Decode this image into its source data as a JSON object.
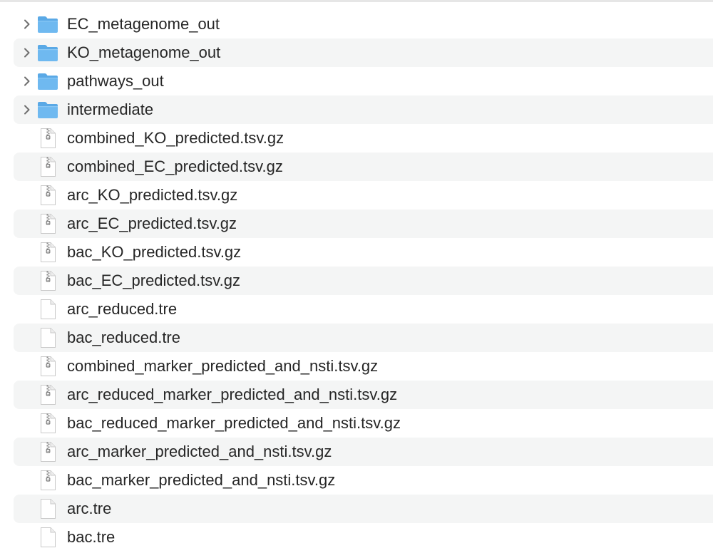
{
  "items": [
    {
      "name": "EC_metagenome_out",
      "kind": "folder"
    },
    {
      "name": "KO_metagenome_out",
      "kind": "folder"
    },
    {
      "name": "pathways_out",
      "kind": "folder"
    },
    {
      "name": "intermediate",
      "kind": "folder"
    },
    {
      "name": "combined_KO_predicted.tsv.gz",
      "kind": "archive"
    },
    {
      "name": "combined_EC_predicted.tsv.gz",
      "kind": "archive"
    },
    {
      "name": "arc_KO_predicted.tsv.gz",
      "kind": "archive"
    },
    {
      "name": "arc_EC_predicted.tsv.gz",
      "kind": "archive"
    },
    {
      "name": "bac_KO_predicted.tsv.gz",
      "kind": "archive"
    },
    {
      "name": "bac_EC_predicted.tsv.gz",
      "kind": "archive"
    },
    {
      "name": "arc_reduced.tre",
      "kind": "document"
    },
    {
      "name": "bac_reduced.tre",
      "kind": "document"
    },
    {
      "name": "combined_marker_predicted_and_nsti.tsv.gz",
      "kind": "archive"
    },
    {
      "name": "arc_reduced_marker_predicted_and_nsti.tsv.gz",
      "kind": "archive"
    },
    {
      "name": "bac_reduced_marker_predicted_and_nsti.tsv.gz",
      "kind": "archive"
    },
    {
      "name": "arc_marker_predicted_and_nsti.tsv.gz",
      "kind": "archive"
    },
    {
      "name": "bac_marker_predicted_and_nsti.tsv.gz",
      "kind": "archive"
    },
    {
      "name": "arc.tre",
      "kind": "document"
    },
    {
      "name": "bac.tre",
      "kind": "document"
    }
  ],
  "icons": {
    "folder": "folder-icon",
    "archive": "archive-file-icon",
    "document": "document-icon",
    "disclosure": "chevron-right-icon"
  },
  "colors": {
    "folder": "#6fb9f0",
    "folder_tab": "#5aa9e6",
    "text": "#262626",
    "row_alternate": "#f4f5f5"
  }
}
